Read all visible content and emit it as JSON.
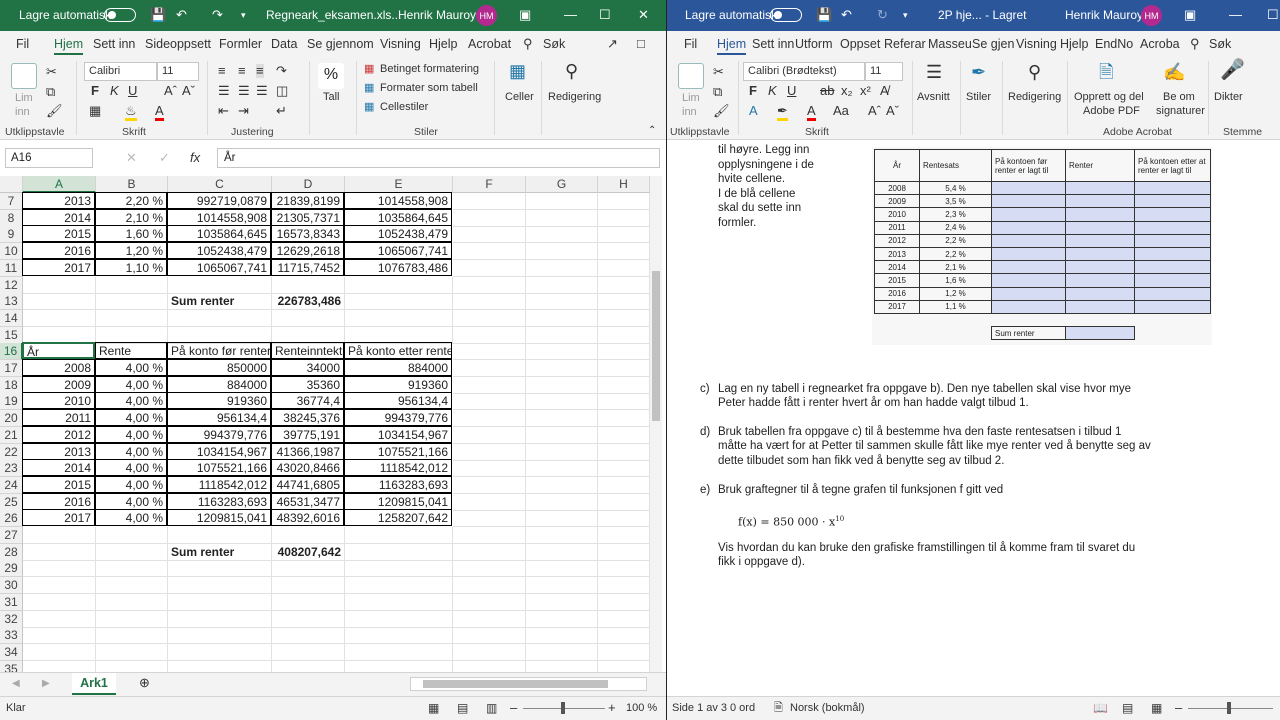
{
  "excel": {
    "title": {
      "autosave": "Lagre automatisk",
      "filename": "Regneark_eksamen.xls...",
      "user": "Henrik Mauroy",
      "initials": "HM"
    },
    "tabs": [
      "Fil",
      "Hjem",
      "Sett inn",
      "Sideoppsett",
      "Formler",
      "Data",
      "Se gjennom",
      "Visning",
      "Hjelp",
      "Acrobat",
      "Søk"
    ],
    "ribbon": {
      "paste": "Lim",
      "paste2": "inn",
      "font": "Calibri",
      "size": "11",
      "percent": "Tall",
      "cond_format": "Betinget formatering",
      "table_format": "Formater som tabell",
      "cell_styles": "Cellestiler",
      "cells": "Celler",
      "editing": "Redigering",
      "groups": [
        "Utklippstavle",
        "Skrift",
        "Justering",
        "Stiler"
      ]
    },
    "formula": {
      "namebox": "A16",
      "content": "År"
    },
    "columns": [
      "A",
      "B",
      "C",
      "D",
      "E",
      "F",
      "G",
      "H"
    ],
    "rows": [
      {
        "n": "7",
        "a": "2013",
        "b": "2,20 %",
        "c": "992719,0879",
        "d": "21839,8199",
        "e": "1014558,908"
      },
      {
        "n": "8",
        "a": "2014",
        "b": "2,10 %",
        "c": "1014558,908",
        "d": "21305,7371",
        "e": "1035864,645"
      },
      {
        "n": "9",
        "a": "2015",
        "b": "1,60 %",
        "c": "1035864,645",
        "d": "16573,8343",
        "e": "1052438,479"
      },
      {
        "n": "10",
        "a": "2016",
        "b": "1,20 %",
        "c": "1052438,479",
        "d": "12629,2618",
        "e": "1065067,741"
      },
      {
        "n": "11",
        "a": "2017",
        "b": "1,10 %",
        "c": "1065067,741",
        "d": "11715,7452",
        "e": "1076783,486"
      },
      {
        "n": "12"
      },
      {
        "n": "13",
        "c": "Sum renter",
        "d": "226783,486"
      },
      {
        "n": "14"
      },
      {
        "n": "15"
      },
      {
        "n": "16",
        "a": "År",
        "b": "Rente",
        "c": "På konto før renter",
        "d": "Renteinntekt",
        "e": "På konto etter rente"
      },
      {
        "n": "17",
        "a": "2008",
        "b": "4,00 %",
        "c": "850000",
        "d": "34000",
        "e": "884000"
      },
      {
        "n": "18",
        "a": "2009",
        "b": "4,00 %",
        "c": "884000",
        "d": "35360",
        "e": "919360"
      },
      {
        "n": "19",
        "a": "2010",
        "b": "4,00 %",
        "c": "919360",
        "d": "36774,4",
        "e": "956134,4"
      },
      {
        "n": "20",
        "a": "2011",
        "b": "4,00 %",
        "c": "956134,4",
        "d": "38245,376",
        "e": "994379,776"
      },
      {
        "n": "21",
        "a": "2012",
        "b": "4,00 %",
        "c": "994379,776",
        "d": "39775,191",
        "e": "1034154,967"
      },
      {
        "n": "22",
        "a": "2013",
        "b": "4,00 %",
        "c": "1034154,967",
        "d": "41366,1987",
        "e": "1075521,166"
      },
      {
        "n": "23",
        "a": "2014",
        "b": "4,00 %",
        "c": "1075521,166",
        "d": "43020,8466",
        "e": "1118542,012"
      },
      {
        "n": "24",
        "a": "2015",
        "b": "4,00 %",
        "c": "1118542,012",
        "d": "44741,6805",
        "e": "1163283,693"
      },
      {
        "n": "25",
        "a": "2016",
        "b": "4,00 %",
        "c": "1163283,693",
        "d": "46531,3477",
        "e": "1209815,041"
      },
      {
        "n": "26",
        "a": "2017",
        "b": "4,00 %",
        "c": "1209815,041",
        "d": "48392,6016",
        "e": "1258207,642"
      },
      {
        "n": "27"
      },
      {
        "n": "28",
        "c": "Sum renter",
        "d": "408207,642"
      },
      {
        "n": "29"
      },
      {
        "n": "30"
      },
      {
        "n": "31"
      },
      {
        "n": "32"
      },
      {
        "n": "33"
      },
      {
        "n": "34"
      },
      {
        "n": "35"
      }
    ],
    "sheet": "Ark1",
    "status": {
      "ready": "Klar",
      "zoom": "100 %"
    }
  },
  "word": {
    "title": {
      "autosave": "Lagre automatisk",
      "filename": "2P hje... - Lagret",
      "user": "Henrik Mauroy",
      "initials": "HM"
    },
    "tabs": [
      "Fil",
      "Hjem",
      "Sett inn",
      "Utform",
      "Oppset",
      "Referar",
      "Masseu",
      "Se gjen",
      "Visning",
      "Hjelp",
      "EndNo",
      "Acroba",
      "Søk"
    ],
    "ribbon": {
      "paste": "Lim",
      "paste2": "inn",
      "font": "Calibri (Brødtekst)",
      "size": "11",
      "paragraph": "Avsnitt",
      "styles": "Stiler",
      "editing": "Redigering",
      "create_pdf": "Opprett og del",
      "create_pdf2": "Adobe PDF",
      "sign": "Be om",
      "sign2": "signaturer",
      "dictate": "Dikter",
      "groups": [
        "Utklippstavle",
        "Skrift",
        "Adobe Acrobat",
        "Stemme"
      ]
    },
    "doc": {
      "side_text": [
        "til høyre. Legg inn",
        "opplysningene i de",
        "hvite cellene.",
        "I de blå cellene",
        "skal du sette inn",
        "formler."
      ],
      "table_head": [
        "År",
        "Rentesats",
        "På kontoen før renter er lagt til",
        "Renter",
        "På kontoen etter at renter er lagt til"
      ],
      "table_rows": [
        [
          "2008",
          "5,4 %"
        ],
        [
          "2009",
          "3,5 %"
        ],
        [
          "2010",
          "2,3 %"
        ],
        [
          "2011",
          "2,4 %"
        ],
        [
          "2012",
          "2,2 %"
        ],
        [
          "2013",
          "2,2 %"
        ],
        [
          "2014",
          "2,1 %"
        ],
        [
          "2015",
          "1,6 %"
        ],
        [
          "2016",
          "1,2 %"
        ],
        [
          "2017",
          "1,1 %"
        ]
      ],
      "sum_label": "Sum renter",
      "c_label": "c)",
      "c_text1": "Lag en ny tabell i regnearket fra oppgave b). Den nye tabellen skal vise hvor mye",
      "c_text2": "Peter hadde fått i renter hvert år om han hadde valgt tilbud 1.",
      "d_label": "d)",
      "d_text1": "Bruk tabellen fra oppgave c) til å bestemme hva den faste rentesatsen i tilbud 1",
      "d_text2": "måtte ha vært for at Petter til sammen skulle fått like mye renter ved å benytte seg av",
      "d_text3": "dette tilbudet som han fikk ved å benytte seg av tilbud 2.",
      "e_label": "e)",
      "e_text1": "Bruk graftegner til å tegne grafen til funksjonen  f  gitt ved",
      "formula": "f(x) = 850 000 · x",
      "formula_exp": "10",
      "e_text2": "Vis hvordan du kan bruke den grafiske framstillingen til å komme fram til svaret du",
      "e_text3": "fikk i oppgave d)."
    },
    "status": {
      "page": "Side 1 av 3",
      "words": "0 ord",
      "lang": "Norsk (bokmål)"
    }
  }
}
